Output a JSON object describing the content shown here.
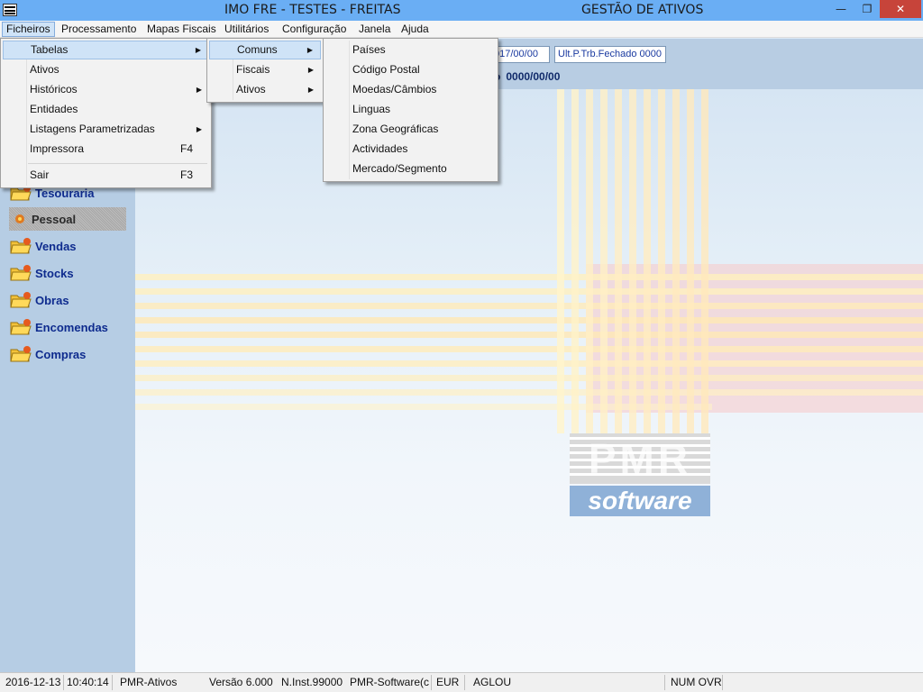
{
  "window": {
    "title_left": "IMO FRE - TESTES - FREITAS",
    "title_right": "GESTÃO DE ATIVOS",
    "min_symbol": "—",
    "max_symbol": "❐",
    "close_symbol": "✕"
  },
  "menubar": [
    "Ficheiros",
    "Processamento",
    "Mapas Fiscais",
    "Utilitários",
    "Configuração",
    "Janela",
    "Ajuda"
  ],
  "info": {
    "field1": "017/00/00",
    "field2": "Ult.P.Trb.Fechado 0000",
    "date_bold": "0000/00/00"
  },
  "sidebar": {
    "items": [
      {
        "label": "Tesouraria",
        "enabled": true
      },
      {
        "label": "Pessoal",
        "enabled": false
      },
      {
        "label": "Vendas",
        "enabled": true
      },
      {
        "label": "Stocks",
        "enabled": true
      },
      {
        "label": "Obras",
        "enabled": true
      },
      {
        "label": "Encomendas",
        "enabled": true
      },
      {
        "label": "Compras",
        "enabled": true
      }
    ]
  },
  "menu_ficheiros": {
    "items": [
      {
        "label": "Tabelas",
        "submenu": true,
        "highlighted": true
      },
      {
        "label": "Ativos"
      },
      {
        "label": "Históricos",
        "submenu": true
      },
      {
        "label": "Entidades"
      },
      {
        "label": "Listagens Parametrizadas",
        "submenu": true
      },
      {
        "label": "Impressora",
        "shortcut": "F4"
      },
      {
        "label": "Sair",
        "shortcut": "F3"
      }
    ],
    "arrow": "▶"
  },
  "menu_tabelas": {
    "items": [
      {
        "label": "Comuns",
        "submenu": true,
        "highlighted": true
      },
      {
        "label": "Fiscais",
        "submenu": true
      },
      {
        "label": "Ativos",
        "submenu": true
      }
    ]
  },
  "menu_comuns": {
    "items": [
      "Países",
      "Código Postal",
      "Moedas/Câmbios",
      "Linguas",
      "Zona Geográficas",
      "Actividades",
      "Mercado/Segmento"
    ]
  },
  "logo": {
    "top_text": "PMR",
    "bottom_text": "software"
  },
  "statusbar": {
    "date": "2016-12-13",
    "time": "10:40:14",
    "module": "PMR-Ativos",
    "version": "Versão  6.000",
    "inst": "N.Inst.99000",
    "company": "PMR-Software(c)",
    "currency": "EUR",
    "user": "AGLOU",
    "keys": "NUM OVR"
  },
  "colors": {
    "titlebar": "#6aaef4",
    "sidebar": "#b6cde4",
    "sidebar_text": "#0e2b8e",
    "close_button": "#c7443a",
    "menu_highlight": "#cfe3f7"
  }
}
